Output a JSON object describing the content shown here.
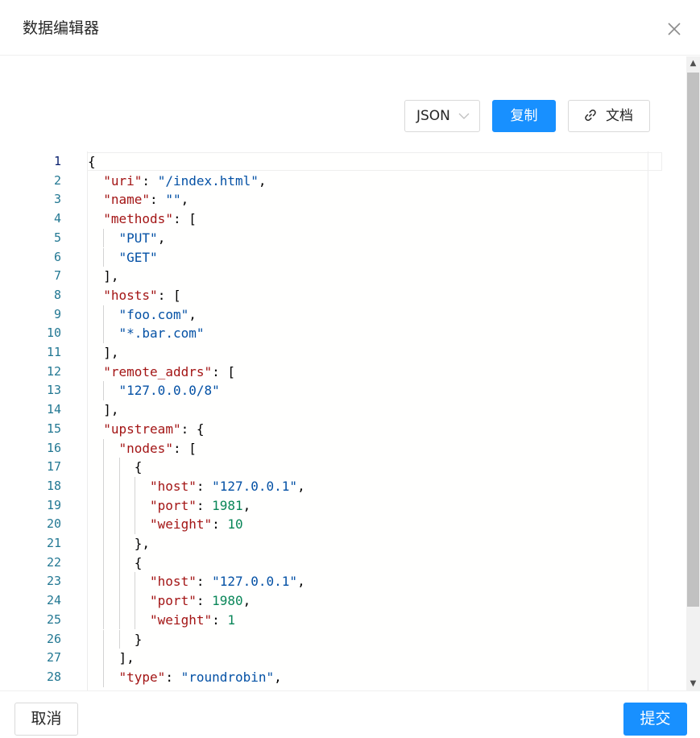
{
  "dialog": {
    "title": "数据编辑器"
  },
  "toolbar": {
    "format_select": "JSON",
    "copy_label": "复制",
    "docs_label": "文档"
  },
  "editor": {
    "active_line": 1,
    "lines": [
      {
        "num": "1",
        "indent": 0,
        "tokens": [
          {
            "t": "p",
            "v": "{"
          }
        ]
      },
      {
        "num": "2",
        "indent": 1,
        "tokens": [
          {
            "t": "k",
            "v": "\"uri\""
          },
          {
            "t": "p",
            "v": ": "
          },
          {
            "t": "s",
            "v": "\"/index.html\""
          },
          {
            "t": "p",
            "v": ","
          }
        ]
      },
      {
        "num": "3",
        "indent": 1,
        "tokens": [
          {
            "t": "k",
            "v": "\"name\""
          },
          {
            "t": "p",
            "v": ": "
          },
          {
            "t": "s",
            "v": "\"\""
          },
          {
            "t": "p",
            "v": ","
          }
        ]
      },
      {
        "num": "4",
        "indent": 1,
        "tokens": [
          {
            "t": "k",
            "v": "\"methods\""
          },
          {
            "t": "p",
            "v": ": ["
          }
        ]
      },
      {
        "num": "5",
        "indent": 2,
        "tokens": [
          {
            "t": "s",
            "v": "\"PUT\""
          },
          {
            "t": "p",
            "v": ","
          }
        ]
      },
      {
        "num": "6",
        "indent": 2,
        "tokens": [
          {
            "t": "s",
            "v": "\"GET\""
          }
        ]
      },
      {
        "num": "7",
        "indent": 1,
        "tokens": [
          {
            "t": "p",
            "v": "],"
          }
        ]
      },
      {
        "num": "8",
        "indent": 1,
        "tokens": [
          {
            "t": "k",
            "v": "\"hosts\""
          },
          {
            "t": "p",
            "v": ": ["
          }
        ]
      },
      {
        "num": "9",
        "indent": 2,
        "tokens": [
          {
            "t": "s",
            "v": "\"foo.com\""
          },
          {
            "t": "p",
            "v": ","
          }
        ]
      },
      {
        "num": "10",
        "indent": 2,
        "tokens": [
          {
            "t": "s",
            "v": "\"*.bar.com\""
          }
        ]
      },
      {
        "num": "11",
        "indent": 1,
        "tokens": [
          {
            "t": "p",
            "v": "],"
          }
        ]
      },
      {
        "num": "12",
        "indent": 1,
        "tokens": [
          {
            "t": "k",
            "v": "\"remote_addrs\""
          },
          {
            "t": "p",
            "v": ": ["
          }
        ]
      },
      {
        "num": "13",
        "indent": 2,
        "tokens": [
          {
            "t": "s",
            "v": "\"127.0.0.0/8\""
          }
        ]
      },
      {
        "num": "14",
        "indent": 1,
        "tokens": [
          {
            "t": "p",
            "v": "],"
          }
        ]
      },
      {
        "num": "15",
        "indent": 1,
        "tokens": [
          {
            "t": "k",
            "v": "\"upstream\""
          },
          {
            "t": "p",
            "v": ": {"
          }
        ]
      },
      {
        "num": "16",
        "indent": 2,
        "tokens": [
          {
            "t": "k",
            "v": "\"nodes\""
          },
          {
            "t": "p",
            "v": ": ["
          }
        ]
      },
      {
        "num": "17",
        "indent": 3,
        "tokens": [
          {
            "t": "p",
            "v": "{"
          }
        ]
      },
      {
        "num": "18",
        "indent": 4,
        "tokens": [
          {
            "t": "k",
            "v": "\"host\""
          },
          {
            "t": "p",
            "v": ": "
          },
          {
            "t": "s",
            "v": "\"127.0.0.1\""
          },
          {
            "t": "p",
            "v": ","
          }
        ]
      },
      {
        "num": "19",
        "indent": 4,
        "tokens": [
          {
            "t": "k",
            "v": "\"port\""
          },
          {
            "t": "p",
            "v": ": "
          },
          {
            "t": "n",
            "v": "1981"
          },
          {
            "t": "p",
            "v": ","
          }
        ]
      },
      {
        "num": "20",
        "indent": 4,
        "tokens": [
          {
            "t": "k",
            "v": "\"weight\""
          },
          {
            "t": "p",
            "v": ": "
          },
          {
            "t": "n",
            "v": "10"
          }
        ]
      },
      {
        "num": "21",
        "indent": 3,
        "tokens": [
          {
            "t": "p",
            "v": "},"
          }
        ]
      },
      {
        "num": "22",
        "indent": 3,
        "tokens": [
          {
            "t": "p",
            "v": "{"
          }
        ]
      },
      {
        "num": "23",
        "indent": 4,
        "tokens": [
          {
            "t": "k",
            "v": "\"host\""
          },
          {
            "t": "p",
            "v": ": "
          },
          {
            "t": "s",
            "v": "\"127.0.0.1\""
          },
          {
            "t": "p",
            "v": ","
          }
        ]
      },
      {
        "num": "24",
        "indent": 4,
        "tokens": [
          {
            "t": "k",
            "v": "\"port\""
          },
          {
            "t": "p",
            "v": ": "
          },
          {
            "t": "n",
            "v": "1980"
          },
          {
            "t": "p",
            "v": ","
          }
        ]
      },
      {
        "num": "25",
        "indent": 4,
        "tokens": [
          {
            "t": "k",
            "v": "\"weight\""
          },
          {
            "t": "p",
            "v": ": "
          },
          {
            "t": "n",
            "v": "1"
          }
        ]
      },
      {
        "num": "26",
        "indent": 3,
        "tokens": [
          {
            "t": "p",
            "v": "}"
          }
        ]
      },
      {
        "num": "27",
        "indent": 2,
        "tokens": [
          {
            "t": "p",
            "v": "],"
          }
        ]
      },
      {
        "num": "28",
        "indent": 2,
        "tokens": [
          {
            "t": "k",
            "v": "\"type\""
          },
          {
            "t": "p",
            "v": ": "
          },
          {
            "t": "s",
            "v": "\"roundrobin\""
          },
          {
            "t": "p",
            "v": ","
          }
        ]
      }
    ]
  },
  "footer": {
    "cancel_label": "取消",
    "submit_label": "提交"
  },
  "colors": {
    "primary": "#1890ff",
    "json_key": "#a31515",
    "json_string": "#0451a5",
    "json_number": "#098658",
    "line_number": "#237893"
  },
  "icons": [
    "close-icon",
    "chevron-down-icon",
    "link-icon",
    "scroll-up-icon",
    "scroll-down-icon"
  ]
}
